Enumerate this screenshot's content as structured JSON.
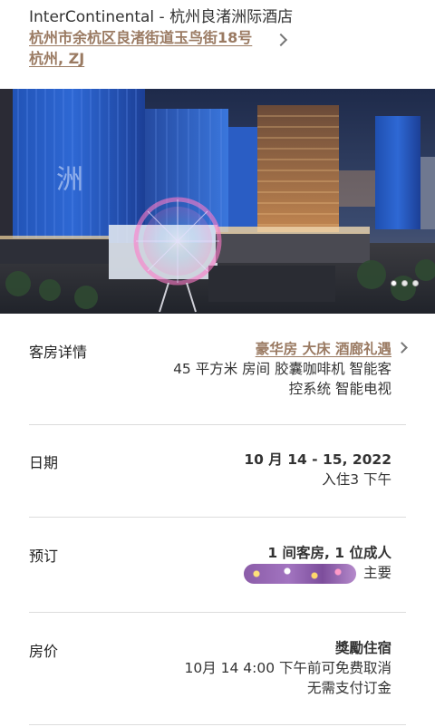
{
  "header": {
    "hotel_name": "InterContinental - 杭州良渚洲际酒店",
    "address_line1": "杭州市余杭区良渚街道玉鸟街18号",
    "address_line2": "杭州, ZJ"
  },
  "hero": {
    "image_desc": "hotel-exterior-night-photo",
    "dots": [
      {
        "active": true
      },
      {
        "active": false
      },
      {
        "active": false
      }
    ]
  },
  "room": {
    "label": "客房详情",
    "room_type": "豪华房 大床 酒廊礼遇",
    "amenities_line1": "45 平方米 房间 胶囊咖啡机 智能客",
    "amenities_line2": "控系统 智能电视"
  },
  "date": {
    "label": "日期",
    "range": "10 月 14 - 15, 2022",
    "checkin": "入住3 下午"
  },
  "booking": {
    "label": "预订",
    "summary": "1 间客房, 1 位成人",
    "guest_role": "主要"
  },
  "price": {
    "label": "房价",
    "rate_name": "獎勵住宿",
    "cancel_policy": "10月 14 4:00 下午前可免费取消",
    "deposit": "无需支付订金"
  },
  "colors": {
    "accent": "#9a7a62",
    "divider": "#dcdcdc"
  }
}
